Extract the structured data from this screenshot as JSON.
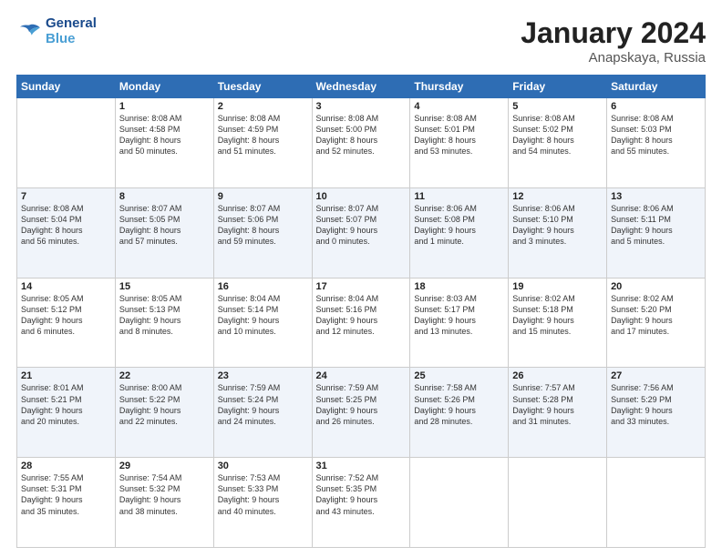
{
  "header": {
    "logo_line1": "General",
    "logo_line2": "Blue",
    "month": "January 2024",
    "location": "Anapskaya, Russia"
  },
  "weekdays": [
    "Sunday",
    "Monday",
    "Tuesday",
    "Wednesday",
    "Thursday",
    "Friday",
    "Saturday"
  ],
  "weeks": [
    [
      {
        "day": "",
        "info": ""
      },
      {
        "day": "1",
        "info": "Sunrise: 8:08 AM\nSunset: 4:58 PM\nDaylight: 8 hours\nand 50 minutes."
      },
      {
        "day": "2",
        "info": "Sunrise: 8:08 AM\nSunset: 4:59 PM\nDaylight: 8 hours\nand 51 minutes."
      },
      {
        "day": "3",
        "info": "Sunrise: 8:08 AM\nSunset: 5:00 PM\nDaylight: 8 hours\nand 52 minutes."
      },
      {
        "day": "4",
        "info": "Sunrise: 8:08 AM\nSunset: 5:01 PM\nDaylight: 8 hours\nand 53 minutes."
      },
      {
        "day": "5",
        "info": "Sunrise: 8:08 AM\nSunset: 5:02 PM\nDaylight: 8 hours\nand 54 minutes."
      },
      {
        "day": "6",
        "info": "Sunrise: 8:08 AM\nSunset: 5:03 PM\nDaylight: 8 hours\nand 55 minutes."
      }
    ],
    [
      {
        "day": "7",
        "info": "Sunrise: 8:08 AM\nSunset: 5:04 PM\nDaylight: 8 hours\nand 56 minutes."
      },
      {
        "day": "8",
        "info": "Sunrise: 8:07 AM\nSunset: 5:05 PM\nDaylight: 8 hours\nand 57 minutes."
      },
      {
        "day": "9",
        "info": "Sunrise: 8:07 AM\nSunset: 5:06 PM\nDaylight: 8 hours\nand 59 minutes."
      },
      {
        "day": "10",
        "info": "Sunrise: 8:07 AM\nSunset: 5:07 PM\nDaylight: 9 hours\nand 0 minutes."
      },
      {
        "day": "11",
        "info": "Sunrise: 8:06 AM\nSunset: 5:08 PM\nDaylight: 9 hours\nand 1 minute."
      },
      {
        "day": "12",
        "info": "Sunrise: 8:06 AM\nSunset: 5:10 PM\nDaylight: 9 hours\nand 3 minutes."
      },
      {
        "day": "13",
        "info": "Sunrise: 8:06 AM\nSunset: 5:11 PM\nDaylight: 9 hours\nand 5 minutes."
      }
    ],
    [
      {
        "day": "14",
        "info": "Sunrise: 8:05 AM\nSunset: 5:12 PM\nDaylight: 9 hours\nand 6 minutes."
      },
      {
        "day": "15",
        "info": "Sunrise: 8:05 AM\nSunset: 5:13 PM\nDaylight: 9 hours\nand 8 minutes."
      },
      {
        "day": "16",
        "info": "Sunrise: 8:04 AM\nSunset: 5:14 PM\nDaylight: 9 hours\nand 10 minutes."
      },
      {
        "day": "17",
        "info": "Sunrise: 8:04 AM\nSunset: 5:16 PM\nDaylight: 9 hours\nand 12 minutes."
      },
      {
        "day": "18",
        "info": "Sunrise: 8:03 AM\nSunset: 5:17 PM\nDaylight: 9 hours\nand 13 minutes."
      },
      {
        "day": "19",
        "info": "Sunrise: 8:02 AM\nSunset: 5:18 PM\nDaylight: 9 hours\nand 15 minutes."
      },
      {
        "day": "20",
        "info": "Sunrise: 8:02 AM\nSunset: 5:20 PM\nDaylight: 9 hours\nand 17 minutes."
      }
    ],
    [
      {
        "day": "21",
        "info": "Sunrise: 8:01 AM\nSunset: 5:21 PM\nDaylight: 9 hours\nand 20 minutes."
      },
      {
        "day": "22",
        "info": "Sunrise: 8:00 AM\nSunset: 5:22 PM\nDaylight: 9 hours\nand 22 minutes."
      },
      {
        "day": "23",
        "info": "Sunrise: 7:59 AM\nSunset: 5:24 PM\nDaylight: 9 hours\nand 24 minutes."
      },
      {
        "day": "24",
        "info": "Sunrise: 7:59 AM\nSunset: 5:25 PM\nDaylight: 9 hours\nand 26 minutes."
      },
      {
        "day": "25",
        "info": "Sunrise: 7:58 AM\nSunset: 5:26 PM\nDaylight: 9 hours\nand 28 minutes."
      },
      {
        "day": "26",
        "info": "Sunrise: 7:57 AM\nSunset: 5:28 PM\nDaylight: 9 hours\nand 31 minutes."
      },
      {
        "day": "27",
        "info": "Sunrise: 7:56 AM\nSunset: 5:29 PM\nDaylight: 9 hours\nand 33 minutes."
      }
    ],
    [
      {
        "day": "28",
        "info": "Sunrise: 7:55 AM\nSunset: 5:31 PM\nDaylight: 9 hours\nand 35 minutes."
      },
      {
        "day": "29",
        "info": "Sunrise: 7:54 AM\nSunset: 5:32 PM\nDaylight: 9 hours\nand 38 minutes."
      },
      {
        "day": "30",
        "info": "Sunrise: 7:53 AM\nSunset: 5:33 PM\nDaylight: 9 hours\nand 40 minutes."
      },
      {
        "day": "31",
        "info": "Sunrise: 7:52 AM\nSunset: 5:35 PM\nDaylight: 9 hours\nand 43 minutes."
      },
      {
        "day": "",
        "info": ""
      },
      {
        "day": "",
        "info": ""
      },
      {
        "day": "",
        "info": ""
      }
    ]
  ]
}
